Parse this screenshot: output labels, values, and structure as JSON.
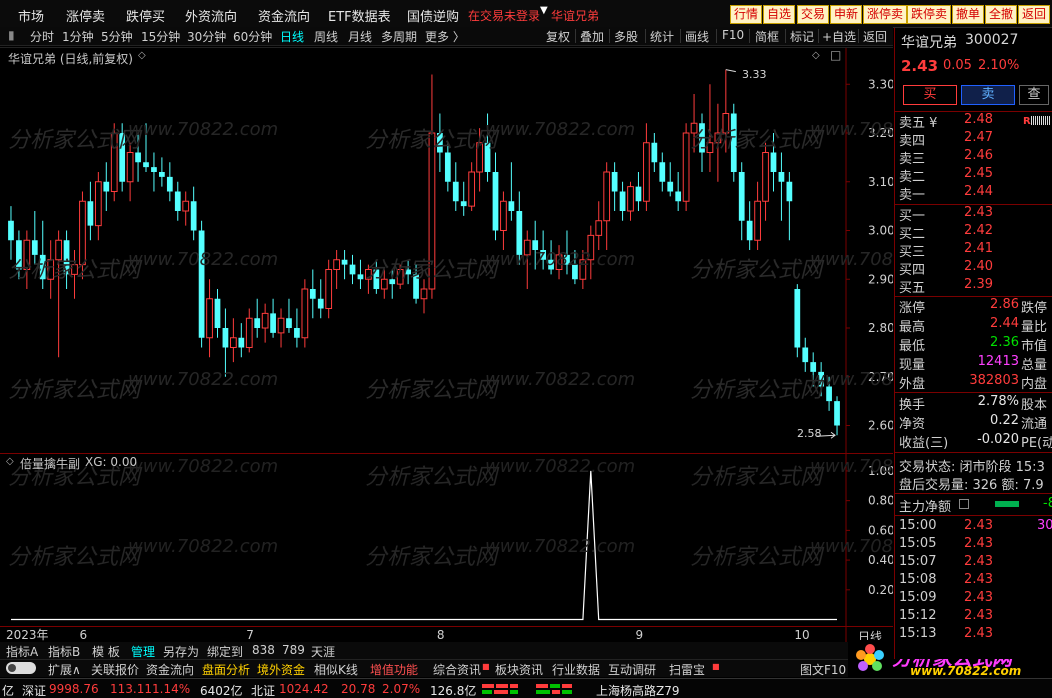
{
  "menubar": {
    "items": [
      "市场",
      "涨停卖",
      "跌停买",
      "外资流向",
      "资金流向",
      "ETF数据表",
      "国债逆购"
    ],
    "notice": "在交易未登录",
    "stock_tag": "华谊兄弟",
    "quick_buttons": [
      "行情",
      "自选",
      "交易",
      "申新",
      "涨停卖",
      "跌停卖",
      "撤单",
      "全撤",
      "返回"
    ]
  },
  "toolbar": {
    "left_items": [
      "分时",
      "1分钟",
      "5分钟",
      "15分钟",
      "30分钟",
      "60分钟",
      "日线",
      "周线",
      "月线",
      "多周期",
      "更多 〉"
    ],
    "active": "日线",
    "right_items": [
      "复权",
      "叠加",
      "多股",
      "统计",
      "画线",
      "F10",
      "简框",
      "标记",
      "+自选",
      "返回"
    ]
  },
  "main_chart": {
    "title": "华谊兄弟 (日线,前复权)",
    "high_label": "3.33",
    "low_label": "2.58"
  },
  "indicator": {
    "title": "倍量擒牛副",
    "value_label": "XG: 0.00"
  },
  "chart_data": [
    {
      "type": "candlestick",
      "y_ticks": [
        "3.30",
        "3.20",
        "3.10",
        "3.00",
        "2.90",
        "2.80",
        "2.70",
        "2.60"
      ],
      "ylim": [
        2.56,
        3.36
      ],
      "x_labels": [
        "2023年",
        "6",
        "7",
        "8",
        "9",
        "10"
      ],
      "x_label_index": [
        0,
        9,
        30,
        54,
        79,
        99
      ],
      "up_color": "#ff3c3c",
      "down_color": "#54ffff",
      "candles": [
        {
          "o": 3.02,
          "h": 3.05,
          "l": 2.94,
          "c": 2.98
        },
        {
          "o": 2.98,
          "h": 3.0,
          "l": 2.9,
          "c": 2.92
        },
        {
          "o": 2.92,
          "h": 3.0,
          "l": 2.88,
          "c": 2.98
        },
        {
          "o": 2.98,
          "h": 3.04,
          "l": 2.93,
          "c": 2.95
        },
        {
          "o": 2.95,
          "h": 3.02,
          "l": 2.88,
          "c": 2.9
        },
        {
          "o": 2.9,
          "h": 2.98,
          "l": 2.86,
          "c": 2.94
        },
        {
          "o": 2.94,
          "h": 3.0,
          "l": 2.74,
          "c": 2.98
        },
        {
          "o": 2.98,
          "h": 3.0,
          "l": 2.88,
          "c": 2.91
        },
        {
          "o": 2.91,
          "h": 2.96,
          "l": 2.86,
          "c": 2.93
        },
        {
          "o": 2.93,
          "h": 3.08,
          "l": 2.9,
          "c": 3.06
        },
        {
          "o": 3.06,
          "h": 3.1,
          "l": 2.98,
          "c": 3.01
        },
        {
          "o": 3.01,
          "h": 3.12,
          "l": 2.98,
          "c": 3.1
        },
        {
          "o": 3.1,
          "h": 3.14,
          "l": 3.04,
          "c": 3.08
        },
        {
          "o": 3.08,
          "h": 3.22,
          "l": 3.06,
          "c": 3.2
        },
        {
          "o": 3.2,
          "h": 3.22,
          "l": 3.08,
          "c": 3.1
        },
        {
          "o": 3.1,
          "h": 3.18,
          "l": 3.06,
          "c": 3.16
        },
        {
          "o": 3.16,
          "h": 3.2,
          "l": 3.1,
          "c": 3.14
        },
        {
          "o": 3.14,
          "h": 3.22,
          "l": 3.12,
          "c": 3.13
        },
        {
          "o": 3.13,
          "h": 3.16,
          "l": 3.08,
          "c": 3.12
        },
        {
          "o": 3.12,
          "h": 3.15,
          "l": 3.09,
          "c": 3.11
        },
        {
          "o": 3.11,
          "h": 3.14,
          "l": 3.06,
          "c": 3.08
        },
        {
          "o": 3.08,
          "h": 3.1,
          "l": 3.02,
          "c": 3.04
        },
        {
          "o": 3.04,
          "h": 3.08,
          "l": 3.01,
          "c": 3.06
        },
        {
          "o": 3.06,
          "h": 3.09,
          "l": 2.98,
          "c": 3.0
        },
        {
          "o": 3.0,
          "h": 3.02,
          "l": 2.76,
          "c": 2.78
        },
        {
          "o": 2.78,
          "h": 2.9,
          "l": 2.74,
          "c": 2.86
        },
        {
          "o": 2.86,
          "h": 2.88,
          "l": 2.78,
          "c": 2.8
        },
        {
          "o": 2.8,
          "h": 2.84,
          "l": 2.7,
          "c": 2.76
        },
        {
          "o": 2.76,
          "h": 2.82,
          "l": 2.73,
          "c": 2.78
        },
        {
          "o": 2.78,
          "h": 2.81,
          "l": 2.74,
          "c": 2.76
        },
        {
          "o": 2.76,
          "h": 2.84,
          "l": 2.75,
          "c": 2.82
        },
        {
          "o": 2.82,
          "h": 2.86,
          "l": 2.78,
          "c": 2.8
        },
        {
          "o": 2.8,
          "h": 2.85,
          "l": 2.77,
          "c": 2.83
        },
        {
          "o": 2.83,
          "h": 2.86,
          "l": 2.78,
          "c": 2.79
        },
        {
          "o": 2.79,
          "h": 2.84,
          "l": 2.76,
          "c": 2.82
        },
        {
          "o": 2.82,
          "h": 2.86,
          "l": 2.79,
          "c": 2.8
        },
        {
          "o": 2.8,
          "h": 2.84,
          "l": 2.76,
          "c": 2.78
        },
        {
          "o": 2.78,
          "h": 2.9,
          "l": 2.76,
          "c": 2.88
        },
        {
          "o": 2.88,
          "h": 2.92,
          "l": 2.82,
          "c": 2.86
        },
        {
          "o": 2.86,
          "h": 2.9,
          "l": 2.82,
          "c": 2.84
        },
        {
          "o": 2.84,
          "h": 2.94,
          "l": 2.82,
          "c": 2.92
        },
        {
          "o": 2.92,
          "h": 2.96,
          "l": 2.88,
          "c": 2.94
        },
        {
          "o": 2.94,
          "h": 2.96,
          "l": 2.9,
          "c": 2.93
        },
        {
          "o": 2.93,
          "h": 2.95,
          "l": 2.89,
          "c": 2.91
        },
        {
          "o": 2.91,
          "h": 2.94,
          "l": 2.88,
          "c": 2.9
        },
        {
          "o": 2.9,
          "h": 2.93,
          "l": 2.87,
          "c": 2.92
        },
        {
          "o": 2.92,
          "h": 2.94,
          "l": 2.87,
          "c": 2.88
        },
        {
          "o": 2.88,
          "h": 2.92,
          "l": 2.86,
          "c": 2.9
        },
        {
          "o": 2.9,
          "h": 2.92,
          "l": 2.86,
          "c": 2.89
        },
        {
          "o": 2.89,
          "h": 2.93,
          "l": 2.88,
          "c": 2.92
        },
        {
          "o": 2.92,
          "h": 2.94,
          "l": 2.89,
          "c": 2.91
        },
        {
          "o": 2.91,
          "h": 2.93,
          "l": 2.85,
          "c": 2.86
        },
        {
          "o": 2.86,
          "h": 2.9,
          "l": 2.83,
          "c": 2.88
        },
        {
          "o": 2.88,
          "h": 3.32,
          "l": 2.86,
          "c": 3.2
        },
        {
          "o": 3.2,
          "h": 3.24,
          "l": 3.12,
          "c": 3.16
        },
        {
          "o": 3.16,
          "h": 3.18,
          "l": 3.08,
          "c": 3.1
        },
        {
          "o": 3.1,
          "h": 3.14,
          "l": 3.04,
          "c": 3.06
        },
        {
          "o": 3.06,
          "h": 3.1,
          "l": 3.03,
          "c": 3.05
        },
        {
          "o": 3.05,
          "h": 3.14,
          "l": 3.04,
          "c": 3.12
        },
        {
          "o": 3.12,
          "h": 3.21,
          "l": 3.08,
          "c": 3.18
        },
        {
          "o": 3.18,
          "h": 3.24,
          "l": 3.1,
          "c": 3.12
        },
        {
          "o": 3.12,
          "h": 3.16,
          "l": 2.98,
          "c": 3.0
        },
        {
          "o": 3.0,
          "h": 3.08,
          "l": 2.96,
          "c": 3.06
        },
        {
          "o": 3.06,
          "h": 3.14,
          "l": 3.02,
          "c": 3.04
        },
        {
          "o": 3.04,
          "h": 3.08,
          "l": 2.93,
          "c": 2.95
        },
        {
          "o": 2.95,
          "h": 3.0,
          "l": 2.88,
          "c": 2.98
        },
        {
          "o": 2.98,
          "h": 3.02,
          "l": 2.92,
          "c": 2.96
        },
        {
          "o": 2.96,
          "h": 3.0,
          "l": 2.92,
          "c": 2.94
        },
        {
          "o": 2.94,
          "h": 2.98,
          "l": 2.91,
          "c": 2.92
        },
        {
          "o": 2.92,
          "h": 2.97,
          "l": 2.9,
          "c": 2.95
        },
        {
          "o": 2.95,
          "h": 3.0,
          "l": 2.91,
          "c": 2.93
        },
        {
          "o": 2.93,
          "h": 2.96,
          "l": 2.89,
          "c": 2.9
        },
        {
          "o": 2.9,
          "h": 2.96,
          "l": 2.88,
          "c": 2.94
        },
        {
          "o": 2.94,
          "h": 3.01,
          "l": 2.9,
          "c": 2.99
        },
        {
          "o": 2.99,
          "h": 3.06,
          "l": 2.96,
          "c": 3.02
        },
        {
          "o": 3.02,
          "h": 3.14,
          "l": 2.96,
          "c": 3.12
        },
        {
          "o": 3.12,
          "h": 3.14,
          "l": 3.04,
          "c": 3.08
        },
        {
          "o": 3.08,
          "h": 3.1,
          "l": 3.02,
          "c": 3.04
        },
        {
          "o": 3.04,
          "h": 3.1,
          "l": 3.02,
          "c": 3.09
        },
        {
          "o": 3.09,
          "h": 3.12,
          "l": 3.04,
          "c": 3.06
        },
        {
          "o": 3.06,
          "h": 3.22,
          "l": 3.04,
          "c": 3.18
        },
        {
          "o": 3.18,
          "h": 3.2,
          "l": 3.12,
          "c": 3.14
        },
        {
          "o": 3.14,
          "h": 3.16,
          "l": 3.08,
          "c": 3.1
        },
        {
          "o": 3.1,
          "h": 3.14,
          "l": 3.07,
          "c": 3.08
        },
        {
          "o": 3.08,
          "h": 3.12,
          "l": 3.04,
          "c": 3.06
        },
        {
          "o": 3.06,
          "h": 3.22,
          "l": 3.04,
          "c": 3.2
        },
        {
          "o": 3.2,
          "h": 3.28,
          "l": 3.16,
          "c": 3.22
        },
        {
          "o": 3.22,
          "h": 3.24,
          "l": 3.12,
          "c": 3.16
        },
        {
          "o": 3.16,
          "h": 3.3,
          "l": 3.12,
          "c": 3.18
        },
        {
          "o": 3.18,
          "h": 3.26,
          "l": 3.1,
          "c": 3.2
        },
        {
          "o": 3.2,
          "h": 3.33,
          "l": 3.16,
          "c": 3.24
        },
        {
          "o": 3.24,
          "h": 3.26,
          "l": 3.1,
          "c": 3.12
        },
        {
          "o": 3.12,
          "h": 3.14,
          "l": 2.98,
          "c": 3.02
        },
        {
          "o": 3.02,
          "h": 3.06,
          "l": 2.96,
          "c": 2.98
        },
        {
          "o": 2.98,
          "h": 3.1,
          "l": 2.96,
          "c": 3.06
        },
        {
          "o": 3.06,
          "h": 3.18,
          "l": 3.02,
          "c": 3.16
        },
        {
          "o": 3.16,
          "h": 3.2,
          "l": 3.08,
          "c": 3.12
        },
        {
          "o": 3.12,
          "h": 3.16,
          "l": 3.02,
          "c": 3.1
        },
        {
          "o": 3.1,
          "h": 3.12,
          "l": 2.98,
          "c": 3.06
        },
        {
          "o": 2.88,
          "h": 2.89,
          "l": 2.74,
          "c": 2.76
        },
        {
          "o": 2.76,
          "h": 2.78,
          "l": 2.71,
          "c": 2.73
        },
        {
          "o": 2.73,
          "h": 2.75,
          "l": 2.68,
          "c": 2.71
        },
        {
          "o": 2.71,
          "h": 2.73,
          "l": 2.66,
          "c": 2.68
        },
        {
          "o": 2.68,
          "h": 2.7,
          "l": 2.63,
          "c": 2.65
        },
        {
          "o": 2.65,
          "h": 2.66,
          "l": 2.58,
          "c": 2.6
        }
      ]
    },
    {
      "type": "line",
      "y_ticks": [
        "1.00",
        "0.80",
        "0.60",
        "0.40",
        "0.20"
      ],
      "ylim": [
        -0.03,
        1.06
      ],
      "spike_index": 73,
      "spike_value": 1.0
    }
  ],
  "right_panel": {
    "name": "华谊兄弟",
    "code": "300027",
    "price": "2.43",
    "change": "0.05",
    "pct": "2.10%",
    "buy_label": "买",
    "sell_label": "卖",
    "more_label": "查",
    "r_badge": "R",
    "asks": [
      {
        "label": "卖五 ¥",
        "price": "2.48"
      },
      {
        "label": "卖四",
        "price": "2.47"
      },
      {
        "label": "卖三",
        "price": "2.46"
      },
      {
        "label": "卖二",
        "price": "2.45"
      },
      {
        "label": "卖一",
        "price": "2.44"
      }
    ],
    "bids": [
      {
        "label": "买一",
        "price": "2.43"
      },
      {
        "label": "买二",
        "price": "2.42"
      },
      {
        "label": "买三",
        "price": "2.41"
      },
      {
        "label": "买四",
        "price": "2.40"
      },
      {
        "label": "买五",
        "price": "2.39"
      }
    ],
    "stats": [
      {
        "k": "涨停",
        "v": "2.86",
        "k2": "跌停",
        "color": "red"
      },
      {
        "k": "最高",
        "v": "2.44",
        "k2": "量比",
        "color": "red"
      },
      {
        "k": "最低",
        "v": "2.36",
        "k2": "市值",
        "color": "green"
      },
      {
        "k": "现量",
        "v": "12413",
        "k2": "总量",
        "color": "magenta"
      },
      {
        "k": "外盘",
        "v": "382803",
        "k2": "内盘",
        "color": "red"
      },
      {
        "k": "换手",
        "v": "2.78%",
        "k2": "股本",
        "color": "white"
      },
      {
        "k": "净资",
        "v": "0.22",
        "k2": "流通",
        "color": "white"
      },
      {
        "k": "收益(三)",
        "v": "-0.020",
        "k2": "PE(动",
        "color": "white"
      }
    ],
    "trade_status": "交易状态: 闭市阶段 15:3",
    "after_hours": "盘后交易量: 326  额: 7.9",
    "net_flow_label": "主力净额",
    "net_flow_value": "-8",
    "ticks": [
      {
        "t": "15:00",
        "p": "2.43",
        "v": "30"
      },
      {
        "t": "15:05",
        "p": "2.43",
        "v": ""
      },
      {
        "t": "15:07",
        "p": "2.43",
        "v": ""
      },
      {
        "t": "15:08",
        "p": "2.43",
        "v": ""
      },
      {
        "t": "15:09",
        "p": "2.43",
        "v": ""
      },
      {
        "t": "15:12",
        "p": "2.43",
        "v": ""
      },
      {
        "t": "15:13",
        "p": "2.43",
        "v": ""
      }
    ]
  },
  "bottom": {
    "period_label": "日线",
    "tabs1": [
      "指标A",
      "指标B",
      "模 板",
      "管理",
      "另存为",
      "绑定到",
      "838",
      "789",
      "天涯"
    ],
    "tabs1_active": "管理",
    "tabs2": [
      "扩展∧",
      "关联报价",
      "资金流向",
      "盘面分析",
      "境外资金",
      "相似K线",
      "增值功能",
      "综合资讯",
      "板块资讯",
      "行业数据",
      "互动调研",
      "扫雷宝"
    ],
    "tabs2_right": "图文F10"
  },
  "statusbar": {
    "prefix": "亿",
    "sz_label": "深证",
    "sz_value": "9998.76",
    "sz_change": "113.11",
    "sz_pct": "1.14%",
    "sz_amount": "6402亿",
    "bz_label": "北证",
    "bz_value": "1024.42",
    "bz_change": "20.78",
    "bz_pct": "2.07%",
    "bz_amount": "126.8亿",
    "ticker": "上海杨高路Z79"
  },
  "watermark": {
    "text": "分析家公式网",
    "url": "www.70822.com",
    "logo_text": "分析家公式网",
    "logo_url": "www.70822.com"
  }
}
